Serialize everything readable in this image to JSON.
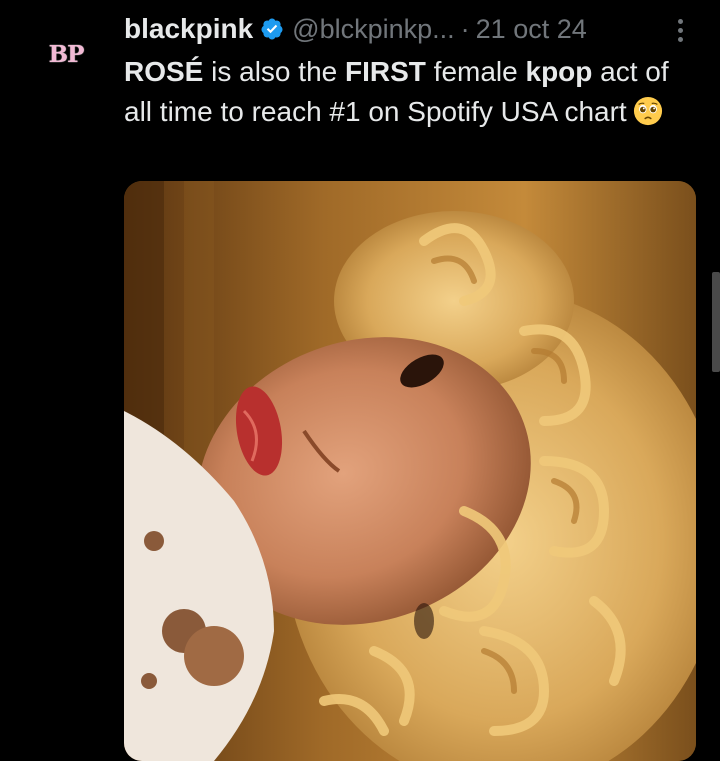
{
  "tweet": {
    "avatar_text": "BP",
    "display_name": "blackpink",
    "handle": "@blckpinkp...",
    "separator": "·",
    "date": "21 oct 24",
    "text_parts": {
      "p1": "ROSÉ",
      "p2": " is also the ",
      "p3": "FIRST",
      "p4": " female ",
      "p5": "kpop",
      "p6": " act of all time to reach #1 on Spotify USA chart"
    },
    "emoji": "pleading-face-emoji",
    "media": "photo-portrait"
  },
  "colors": {
    "background": "#000000",
    "text_primary": "#e7e9ea",
    "text_secondary": "#71767b",
    "verified": "#1d9bf0",
    "avatar_text": "#f1b9d4"
  }
}
